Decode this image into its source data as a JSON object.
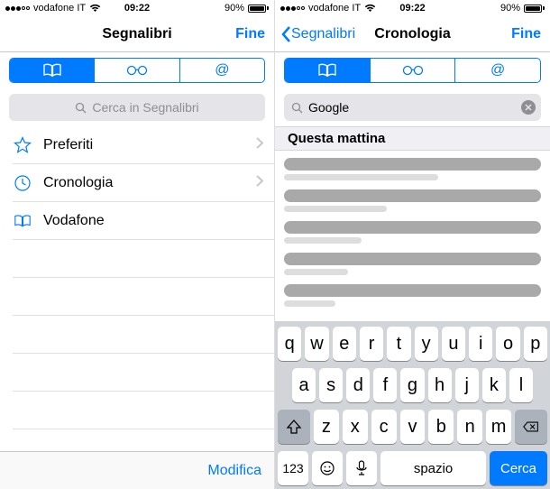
{
  "status": {
    "carrier": "vodafone IT",
    "wifi": true,
    "time": "09:22",
    "batteryPct": "90%"
  },
  "left": {
    "nav": {
      "title": "Segnalibri",
      "done": "Fine"
    },
    "search": {
      "placeholder": "Cerca in Segnalibri"
    },
    "rows": {
      "favorites": "Preferiti",
      "history": "Cronologia",
      "vodafone": "Vodafone"
    },
    "footer": {
      "edit": "Modifica"
    }
  },
  "right": {
    "nav": {
      "back": "Segnalibri",
      "title": "Cronologia",
      "done": "Fine"
    },
    "search": {
      "value": "Google"
    },
    "section": "Questa mattina",
    "keyboard": {
      "row1": [
        "q",
        "w",
        "e",
        "r",
        "t",
        "y",
        "u",
        "i",
        "o",
        "p"
      ],
      "row2": [
        "a",
        "s",
        "d",
        "f",
        "g",
        "h",
        "j",
        "k",
        "l"
      ],
      "row3": [
        "z",
        "x",
        "c",
        "v",
        "b",
        "n",
        "m"
      ],
      "numKey": "123",
      "space": "spazio",
      "search": "Cerca"
    }
  }
}
